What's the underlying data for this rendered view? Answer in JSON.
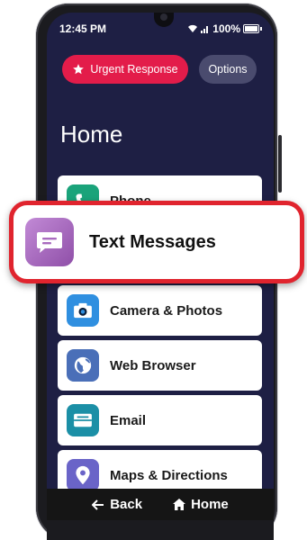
{
  "status_bar": {
    "time": "12:45 PM",
    "battery": "100%"
  },
  "top_buttons": {
    "urgent_label": "Urgent Response",
    "options_label": "Options"
  },
  "page_title": "Home",
  "apps": [
    {
      "label": "Phone",
      "icon": "phone-icon",
      "color": "#1aa37a"
    },
    {
      "label": "Text Messages",
      "icon": "message-icon",
      "color": "#a96bbf"
    },
    {
      "label": "Camera & Photos",
      "icon": "camera-icon",
      "color": "#2f8fe0"
    },
    {
      "label": "Web Browser",
      "icon": "globe-icon",
      "color": "#4a6fb8"
    },
    {
      "label": "Email",
      "icon": "email-icon",
      "color": "#1b8fa6"
    },
    {
      "label": "Maps & Directions",
      "icon": "map-pin-icon",
      "color": "#6a64c8"
    }
  ],
  "nav": {
    "back_label": "Back",
    "home_label": "Home"
  },
  "colors": {
    "screen_bg": "#1e1f44",
    "urgent": "#e31c4a",
    "highlight_border": "#e0242e"
  }
}
